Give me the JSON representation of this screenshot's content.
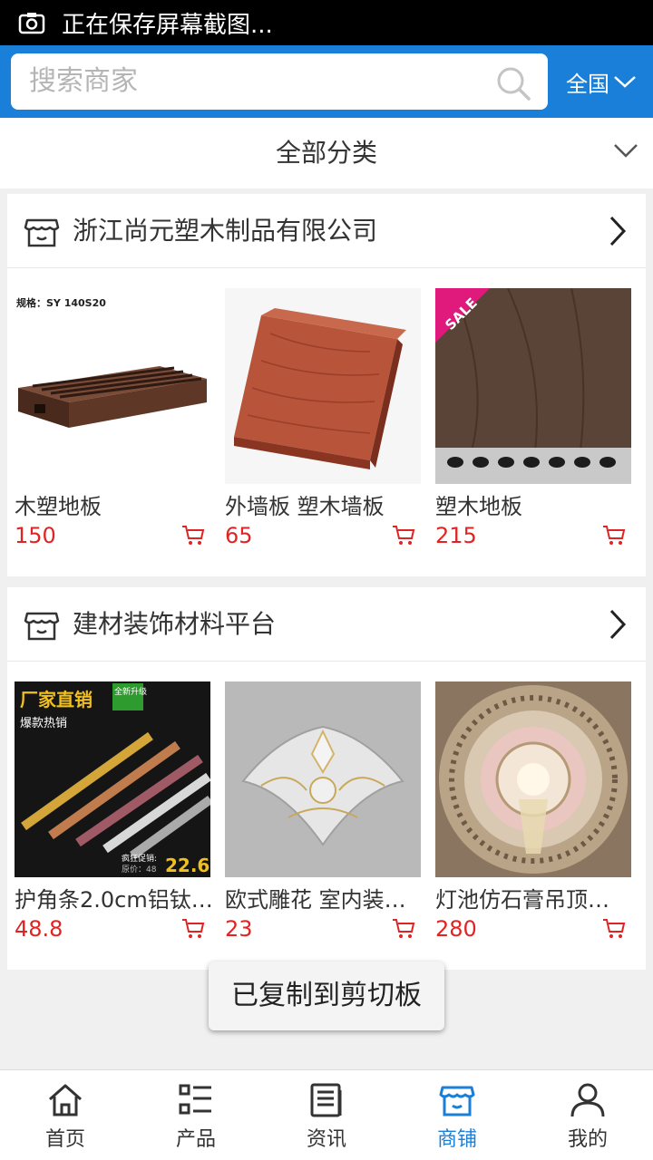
{
  "status": {
    "text": "正在保存屏幕截图..."
  },
  "search": {
    "placeholder": "搜索商家",
    "region": "全国"
  },
  "category": {
    "label": "全部分类"
  },
  "sections": [
    {
      "title": "浙江尚元塑木制品有限公司",
      "products": [
        {
          "name": "木塑地板",
          "price": "150",
          "image_caption": "规格：SY 140S20"
        },
        {
          "name": "外墙板 塑木墙板",
          "price": "65"
        },
        {
          "name": "塑木地板",
          "price": "215",
          "badge": "SALE"
        }
      ]
    },
    {
      "title": "建材装饰材料平台",
      "products": [
        {
          "name": "护角条2.0cm铝钛…",
          "price": "48.8",
          "image_text": {
            "headline": "厂家直销",
            "tag": "全新升级",
            "sub": "爆款热销",
            "promo": "疯狂促销:",
            "orig": "原价：48",
            "promo_price": "22.6"
          }
        },
        {
          "name": "欧式雕花 室内装…",
          "price": "23"
        },
        {
          "name": "灯池仿石膏吊顶…",
          "price": "280"
        }
      ]
    }
  ],
  "toast": "已复制到剪切板",
  "tabs": [
    {
      "label": "首页",
      "icon": "home-icon"
    },
    {
      "label": "产品",
      "icon": "list-icon"
    },
    {
      "label": "资讯",
      "icon": "news-icon"
    },
    {
      "label": "商铺",
      "icon": "shop-icon",
      "active": true
    },
    {
      "label": "我的",
      "icon": "user-icon"
    }
  ],
  "colors": {
    "primary": "#1a7fd8",
    "price": "#e02424"
  }
}
